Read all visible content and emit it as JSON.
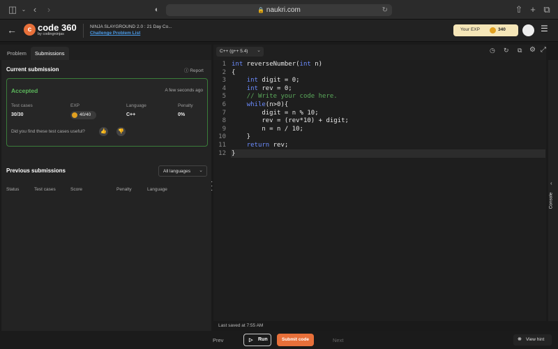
{
  "browser": {
    "url": "naukri.com"
  },
  "app": {
    "logo_main": "code",
    "logo_num": "360",
    "logo_sub": "by codingninjas",
    "contest_title": "NINJA SLAYGROUND 2.0 : 21 Day Co...",
    "challenge_link": "Challenge Problem List",
    "exp_label": "Your EXP",
    "exp_value": "340"
  },
  "tabs": [
    {
      "label": "Problem"
    },
    {
      "label": "Submissions"
    }
  ],
  "current": {
    "title": "Current submission",
    "report": "Report",
    "status": "Accepted",
    "time": "A few seconds ago",
    "test_cases_label": "Test cases",
    "test_cases_value": "30/30",
    "exp_label": "EXP",
    "exp_value": "40/40",
    "language_label": "Language",
    "language_value": "C++",
    "penalty_label": "Penalty",
    "penalty_value": "0%",
    "feedback": "Did you find these test cases useful?"
  },
  "previous": {
    "title": "Previous submissions",
    "filter": "All languages",
    "columns": [
      "Status",
      "Test cases",
      "Score",
      "Penalty",
      "Language"
    ]
  },
  "editor": {
    "language": "C++ (g++ 5.4)",
    "line_numbers": [
      "1",
      "2",
      "3",
      "4",
      "5",
      "6",
      "7",
      "8",
      "9",
      "10",
      "11",
      "12"
    ],
    "saved": "Last saved at 7:55 AM",
    "console": "Console"
  },
  "footer": {
    "prev": "Prev",
    "run": "Run",
    "submit": "Submit code",
    "next": "Next",
    "hint": "View hint"
  },
  "colors": {
    "accent": "#e8703a",
    "success": "#5cb85c",
    "exp_bg": "#f5e6b8"
  }
}
